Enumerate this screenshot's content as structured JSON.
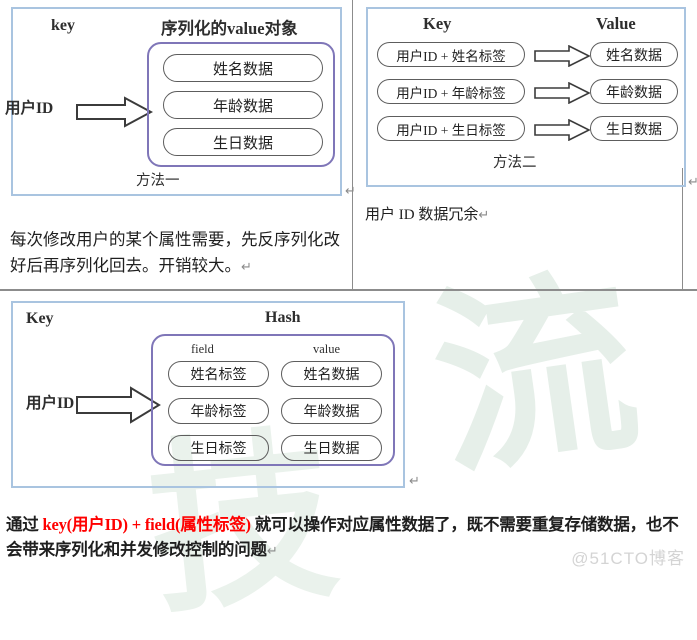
{
  "document": {
    "watermark_brand": "@51CTO博客",
    "watermark_glyph_1": "流",
    "watermark_glyph_2": "技"
  },
  "panel_method_one": {
    "key_header": "key",
    "value_header": "序列化的value对象",
    "side_label": "用户ID",
    "caption": "方法一",
    "arrow_icon": "right-block-arrow-icon",
    "items": [
      "姓名数据",
      "年龄数据",
      "生日数据"
    ]
  },
  "panel_method_two": {
    "key_header": "Key",
    "value_header": "Value",
    "caption": "方法二",
    "arrow_icon": "right-block-arrow-icon",
    "rows": [
      {
        "key": "用户ID + 姓名标签",
        "value": "姓名数据"
      },
      {
        "key": "用户ID + 年龄标签",
        "value": "年龄数据"
      },
      {
        "key": "用户ID + 生日标签",
        "value": "生日数据"
      }
    ]
  },
  "panel_hash": {
    "key_header": "Key",
    "hash_header": "Hash",
    "field_header": "field",
    "value_header": "value",
    "side_label": "用户ID",
    "arrow_icon": "right-block-arrow-icon",
    "rows": [
      {
        "field": "姓名标签",
        "value": "姓名数据"
      },
      {
        "field": "年龄标签",
        "value": "年龄数据"
      },
      {
        "field": "生日标签",
        "value": "生日数据"
      }
    ]
  },
  "notes": {
    "method_one_note": "每次修改用户的某个属性需要，先反序列化改好后再序列化回去。开销较大。",
    "method_two_note": "用户 ID 数据冗余",
    "pilcrow": "↵"
  },
  "conclusion": {
    "prefix": "通过 ",
    "highlight": "key(用户ID) + field(属性标签)",
    "suffix": " 就可以操作对应属性数据了，既不需要重复存储数据，也不会带来序列化和并发修改控制的问题",
    "pilcrow": "↵"
  },
  "colors": {
    "panel_border": "#a9c4e0",
    "inner_box_border": "#7f76b8",
    "pill_border": "#5d5d5d",
    "highlight_red": "#ff0000",
    "divider_gray": "#8c8c8c"
  }
}
